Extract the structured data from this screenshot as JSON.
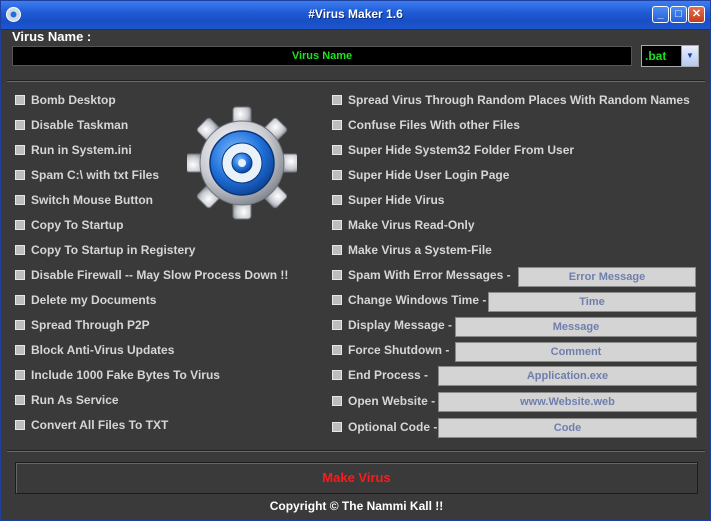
{
  "window": {
    "title": "#Virus Maker 1.6",
    "icon": "gear-icon",
    "controls": [
      "minimize-icon",
      "maximize-icon",
      "close-icon"
    ]
  },
  "virus_name": {
    "label": "Virus Name :",
    "value": "Virus Name"
  },
  "extension": {
    "selected": ".bat"
  },
  "left_options": [
    "Bomb Desktop",
    "Disable Taskman",
    "Run in System.ini",
    "Spam C:\\ with txt Files",
    "Switch Mouse Button",
    "Copy To Startup",
    "Copy To Startup in Registery",
    "Disable Firewall -- May Slow Process Down !!",
    "Delete my Documents",
    "Spread Through P2P",
    "Block Anti-Virus Updates",
    "Include 1000 Fake Bytes To Virus",
    "Run As Service",
    "Convert All Files To TXT"
  ],
  "right_options": [
    "Spread Virus Through Random Places With Random Names",
    "Confuse Files With other Files",
    "Super Hide System32 Folder From User",
    "Super Hide User Login Page",
    "Super Hide Virus",
    "Make Virus Read-Only",
    "Make Virus a System-File",
    "Spam With Error Messages  -",
    "Change Windows Time -",
    "Display Message -",
    "Force Shutdown -",
    "End Process -",
    "Open Website -",
    "Optional Code -"
  ],
  "fields": [
    "Error Message",
    "Time",
    "Message",
    "Comment",
    "Application.exe",
    "www.Website.web",
    "Code"
  ],
  "make_button": "Make Virus",
  "copyright": "Copyright © The Nammi Kall !!",
  "colors": {
    "name_text": "#1ee21e",
    "make_button_text": "#ff1a1a",
    "gear_blue": "#1e6fd9"
  }
}
